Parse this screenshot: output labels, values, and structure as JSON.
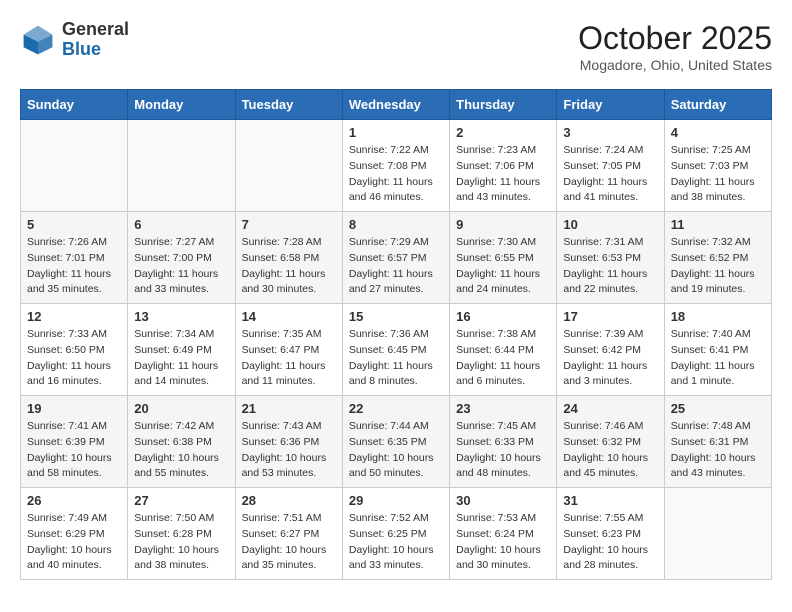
{
  "header": {
    "logo_line1": "General",
    "logo_line2": "Blue",
    "month": "October 2025",
    "location": "Mogadore, Ohio, United States"
  },
  "days_of_week": [
    "Sunday",
    "Monday",
    "Tuesday",
    "Wednesday",
    "Thursday",
    "Friday",
    "Saturday"
  ],
  "weeks": [
    [
      {
        "day": "",
        "info": ""
      },
      {
        "day": "",
        "info": ""
      },
      {
        "day": "",
        "info": ""
      },
      {
        "day": "1",
        "info": "Sunrise: 7:22 AM\nSunset: 7:08 PM\nDaylight: 11 hours\nand 46 minutes."
      },
      {
        "day": "2",
        "info": "Sunrise: 7:23 AM\nSunset: 7:06 PM\nDaylight: 11 hours\nand 43 minutes."
      },
      {
        "day": "3",
        "info": "Sunrise: 7:24 AM\nSunset: 7:05 PM\nDaylight: 11 hours\nand 41 minutes."
      },
      {
        "day": "4",
        "info": "Sunrise: 7:25 AM\nSunset: 7:03 PM\nDaylight: 11 hours\nand 38 minutes."
      }
    ],
    [
      {
        "day": "5",
        "info": "Sunrise: 7:26 AM\nSunset: 7:01 PM\nDaylight: 11 hours\nand 35 minutes."
      },
      {
        "day": "6",
        "info": "Sunrise: 7:27 AM\nSunset: 7:00 PM\nDaylight: 11 hours\nand 33 minutes."
      },
      {
        "day": "7",
        "info": "Sunrise: 7:28 AM\nSunset: 6:58 PM\nDaylight: 11 hours\nand 30 minutes."
      },
      {
        "day": "8",
        "info": "Sunrise: 7:29 AM\nSunset: 6:57 PM\nDaylight: 11 hours\nand 27 minutes."
      },
      {
        "day": "9",
        "info": "Sunrise: 7:30 AM\nSunset: 6:55 PM\nDaylight: 11 hours\nand 24 minutes."
      },
      {
        "day": "10",
        "info": "Sunrise: 7:31 AM\nSunset: 6:53 PM\nDaylight: 11 hours\nand 22 minutes."
      },
      {
        "day": "11",
        "info": "Sunrise: 7:32 AM\nSunset: 6:52 PM\nDaylight: 11 hours\nand 19 minutes."
      }
    ],
    [
      {
        "day": "12",
        "info": "Sunrise: 7:33 AM\nSunset: 6:50 PM\nDaylight: 11 hours\nand 16 minutes."
      },
      {
        "day": "13",
        "info": "Sunrise: 7:34 AM\nSunset: 6:49 PM\nDaylight: 11 hours\nand 14 minutes."
      },
      {
        "day": "14",
        "info": "Sunrise: 7:35 AM\nSunset: 6:47 PM\nDaylight: 11 hours\nand 11 minutes."
      },
      {
        "day": "15",
        "info": "Sunrise: 7:36 AM\nSunset: 6:45 PM\nDaylight: 11 hours\nand 8 minutes."
      },
      {
        "day": "16",
        "info": "Sunrise: 7:38 AM\nSunset: 6:44 PM\nDaylight: 11 hours\nand 6 minutes."
      },
      {
        "day": "17",
        "info": "Sunrise: 7:39 AM\nSunset: 6:42 PM\nDaylight: 11 hours\nand 3 minutes."
      },
      {
        "day": "18",
        "info": "Sunrise: 7:40 AM\nSunset: 6:41 PM\nDaylight: 11 hours\nand 1 minute."
      }
    ],
    [
      {
        "day": "19",
        "info": "Sunrise: 7:41 AM\nSunset: 6:39 PM\nDaylight: 10 hours\nand 58 minutes."
      },
      {
        "day": "20",
        "info": "Sunrise: 7:42 AM\nSunset: 6:38 PM\nDaylight: 10 hours\nand 55 minutes."
      },
      {
        "day": "21",
        "info": "Sunrise: 7:43 AM\nSunset: 6:36 PM\nDaylight: 10 hours\nand 53 minutes."
      },
      {
        "day": "22",
        "info": "Sunrise: 7:44 AM\nSunset: 6:35 PM\nDaylight: 10 hours\nand 50 minutes."
      },
      {
        "day": "23",
        "info": "Sunrise: 7:45 AM\nSunset: 6:33 PM\nDaylight: 10 hours\nand 48 minutes."
      },
      {
        "day": "24",
        "info": "Sunrise: 7:46 AM\nSunset: 6:32 PM\nDaylight: 10 hours\nand 45 minutes."
      },
      {
        "day": "25",
        "info": "Sunrise: 7:48 AM\nSunset: 6:31 PM\nDaylight: 10 hours\nand 43 minutes."
      }
    ],
    [
      {
        "day": "26",
        "info": "Sunrise: 7:49 AM\nSunset: 6:29 PM\nDaylight: 10 hours\nand 40 minutes."
      },
      {
        "day": "27",
        "info": "Sunrise: 7:50 AM\nSunset: 6:28 PM\nDaylight: 10 hours\nand 38 minutes."
      },
      {
        "day": "28",
        "info": "Sunrise: 7:51 AM\nSunset: 6:27 PM\nDaylight: 10 hours\nand 35 minutes."
      },
      {
        "day": "29",
        "info": "Sunrise: 7:52 AM\nSunset: 6:25 PM\nDaylight: 10 hours\nand 33 minutes."
      },
      {
        "day": "30",
        "info": "Sunrise: 7:53 AM\nSunset: 6:24 PM\nDaylight: 10 hours\nand 30 minutes."
      },
      {
        "day": "31",
        "info": "Sunrise: 7:55 AM\nSunset: 6:23 PM\nDaylight: 10 hours\nand 28 minutes."
      },
      {
        "day": "",
        "info": ""
      }
    ]
  ]
}
